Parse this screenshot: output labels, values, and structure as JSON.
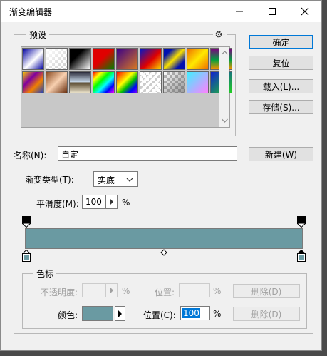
{
  "window": {
    "title": "渐变编辑器"
  },
  "presets": {
    "label": "预设",
    "settings_icon": "gear-icon",
    "swatches": [
      {
        "name": "blue-white",
        "css": "linear-gradient(135deg,#0000a0 0%,#ffffff 55%,#0000a0 100%)"
      },
      {
        "name": "white-transparent",
        "css": "checker-white"
      },
      {
        "name": "black-white",
        "css": "linear-gradient(135deg,#000 35%,#fff 100%)"
      },
      {
        "name": "red-green",
        "css": "linear-gradient(135deg,#e00000 45%,#008000 100%)"
      },
      {
        "name": "violet-orange",
        "css": "linear-gradient(135deg,#3a0088 0%,#d97a20 100%)"
      },
      {
        "name": "blue-red-yellow",
        "css": "linear-gradient(135deg,#0018c8 0%,#e00000 55%,#f8d800 100%)"
      },
      {
        "name": "blue-yellow-blue",
        "css": "linear-gradient(135deg,#0010b0 20%,#f8e000 50%,#0010b0 80%)"
      },
      {
        "name": "orange-yellow-orange",
        "css": "linear-gradient(135deg,#f07000 0%,#ffe800 50%,#f07000 100%)"
      },
      {
        "name": "violet-green-orange",
        "css": "linear-gradient(180deg,#800080 0%,#00a040 55%,#f09000 100%)"
      },
      {
        "name": "yellow-violet-orange-blue",
        "css": "linear-gradient(135deg,#f8c800 0%,#8000a0 35%,#f08000 65%,#2040c0 100%)"
      },
      {
        "name": "copper",
        "css": "linear-gradient(135deg,#8a4a20 0%,#f8d0b0 50%,#6a3010 100%)"
      },
      {
        "name": "chrome",
        "css": "linear-gradient(180deg,#2a2a3a 0%,#c8d8e8 48%,#5a4a30 52%,#e8e0c8 100%)"
      },
      {
        "name": "spectrum",
        "css": "linear-gradient(135deg,#ff0000 0%,#ffff00 20%,#00ff00 40%,#00ffff 60%,#0000ff 80%,#ff00ff 100%)"
      },
      {
        "name": "transparent-rainbow",
        "css": "linear-gradient(135deg,#ff0000 0%,#ff8000 20%,#ffff00 40%,#00c000 60%,#0000ff 80%,#8000ff 100%)"
      },
      {
        "name": "transparent-stripes",
        "css": "checker-stripes"
      },
      {
        "name": "neutral-density",
        "css": "checker-dark"
      },
      {
        "name": "cyan-pink",
        "css": "linear-gradient(135deg,#40f0ff 0%,#ff80ff 100%)"
      },
      {
        "name": "blue-green",
        "css": "linear-gradient(135deg,#1020d0 0%,#20d020 100%)"
      }
    ]
  },
  "buttons": {
    "ok": "确定",
    "reset": "复位",
    "load": "载入(L)...",
    "save": "存储(S)...",
    "new": "新建(W)",
    "delete_opacity": "删除(D)",
    "delete_color": "删除(D)"
  },
  "name_field": {
    "label": "名称(N):",
    "value": "自定"
  },
  "gradient": {
    "type_label": "渐变类型(T):",
    "type_value": "实底",
    "smoothness_label": "平滑度(M):",
    "smoothness_value": "100",
    "smoothness_unit": "%",
    "bar_color": "#6a9aa2",
    "stops_color": "#6a9aa2"
  },
  "color_stops": {
    "group_label": "色标",
    "opacity_label": "不透明度:",
    "opacity_value": "",
    "opacity_unit": "%",
    "opacity_location_label": "位置:",
    "opacity_location_value": "",
    "opacity_location_unit": "%",
    "color_label": "颜色:",
    "color_value": "#6a9aa2",
    "location_label": "位置(C):",
    "location_value": "100",
    "location_unit": "%"
  }
}
